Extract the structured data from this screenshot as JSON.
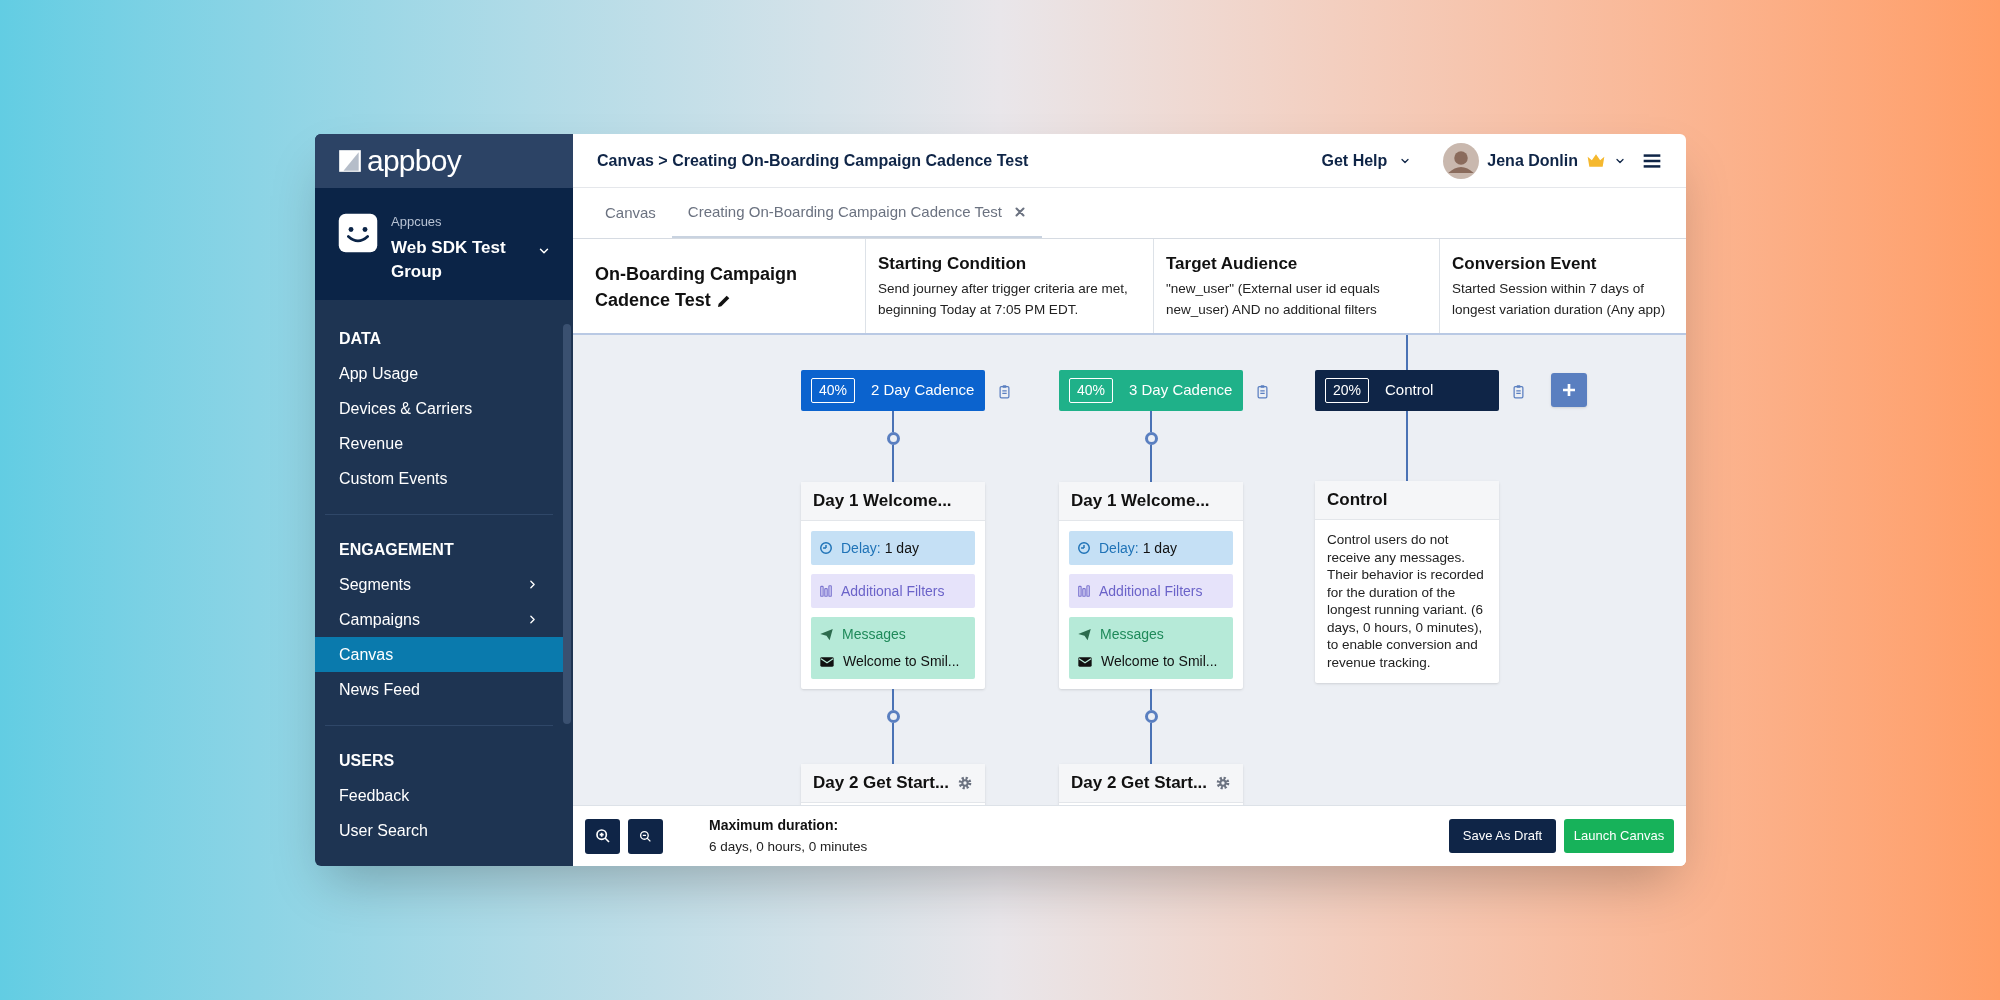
{
  "sidebar": {
    "logo": "appboy",
    "workspace": {
      "company": "Appcues",
      "name": "Web SDK Test Group"
    },
    "sections": [
      {
        "title": "DATA",
        "items": [
          {
            "label": "App Usage",
            "selected": false,
            "has_submenu": false
          },
          {
            "label": "Devices & Carriers",
            "selected": false,
            "has_submenu": false
          },
          {
            "label": "Revenue",
            "selected": false,
            "has_submenu": false
          },
          {
            "label": "Custom Events",
            "selected": false,
            "has_submenu": false
          }
        ]
      },
      {
        "title": "ENGAGEMENT",
        "items": [
          {
            "label": "Segments",
            "selected": false,
            "has_submenu": true
          },
          {
            "label": "Campaigns",
            "selected": false,
            "has_submenu": true
          },
          {
            "label": "Canvas",
            "selected": true,
            "has_submenu": false
          },
          {
            "label": "News Feed",
            "selected": false,
            "has_submenu": false
          }
        ]
      },
      {
        "title": "USERS",
        "items": [
          {
            "label": "Feedback",
            "selected": false,
            "has_submenu": false
          },
          {
            "label": "User Search",
            "selected": false,
            "has_submenu": false
          }
        ]
      }
    ]
  },
  "header": {
    "breadcrumb": "Canvas > Creating On-Boarding Campaign Cadence Test",
    "help": "Get Help",
    "user": "Jena Donlin"
  },
  "tabs": [
    {
      "label": "Canvas",
      "selected": false,
      "closable": false
    },
    {
      "label": "Creating On-Boarding Campaign Cadence Test",
      "selected": true,
      "closable": true
    }
  ],
  "summary": {
    "name": "On-Boarding Campaign Cadence Test",
    "columns": [
      {
        "title": "Starting Condition",
        "text": "Send journey after trigger criteria are met, beginning Today at 7:05 PM EDT."
      },
      {
        "title": "Target Audience",
        "text": "\"new_user\" (External user id equals new_user) AND no additional filters"
      },
      {
        "title": "Conversion Event",
        "text": "Started Session within 7 days of longest variation duration (Any app)"
      }
    ]
  },
  "variants": [
    {
      "kind": "message",
      "percent": "40%",
      "name": "2 Day Cadence",
      "color": "#0b63ce",
      "steps": [
        {
          "title": "Day 1 Welcome...",
          "delay_label": "Delay:",
          "delay": "1 day",
          "filters": "Additional Filters",
          "messages_label": "Messages",
          "message": "Welcome to Smil..."
        },
        {
          "title": "Day 2 Get Start..."
        }
      ]
    },
    {
      "kind": "message",
      "percent": "40%",
      "name": "3 Day Cadence",
      "color": "#1fb189",
      "steps": [
        {
          "title": "Day 1 Welcome...",
          "delay_label": "Delay:",
          "delay": "1 day",
          "filters": "Additional Filters",
          "messages_label": "Messages",
          "message": "Welcome to Smil..."
        },
        {
          "title": "Day 2 Get Start..."
        }
      ]
    },
    {
      "kind": "control",
      "percent": "20%",
      "name": "Control",
      "color": "#0f2547",
      "card_title": "Control",
      "description": "Control users do not receive any messages. Their behavior is recorded for the duration of the longest running variant. (6 days, 0 hours, 0 minutes), to enable conversion and revenue tracking."
    }
  ],
  "footer": {
    "duration_label": "Maximum duration:",
    "duration": "6 days, 0 hours, 0 minutes",
    "buttons": [
      {
        "kind": "draft",
        "label": "Save As Draft"
      },
      {
        "kind": "launch",
        "label": "Launch Canvas"
      }
    ]
  }
}
